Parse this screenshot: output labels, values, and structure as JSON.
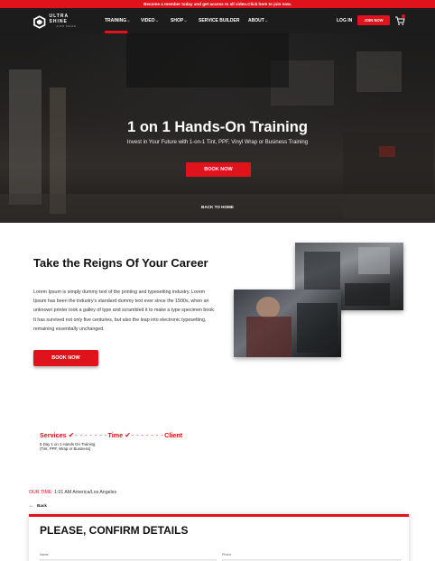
{
  "topbar": {
    "text": "Become a member today and get access to all video.Click here to join now."
  },
  "nav": {
    "logo": {
      "name": "ULTRA SHINE",
      "sub": "AUTO SALON"
    },
    "items": [
      {
        "label": "TRAINING",
        "caret": true,
        "active": true
      },
      {
        "label": "VIDEO",
        "caret": true
      },
      {
        "label": "SHOP",
        "caret": true
      },
      {
        "label": "SERVICE BUILDER",
        "caret": false
      },
      {
        "label": "ABOUT",
        "caret": true
      }
    ],
    "login": "LOG IN",
    "join": "JOIN NOW",
    "cart_icon": "cart-icon"
  },
  "hero": {
    "title": "1 on 1 Hands-On Training",
    "subtitle": "Invest in Your Future with 1-on-1 Tint, PPF, Vinyl Wrap or Business Training",
    "button": "BOOK NOW",
    "back_link": "BACK TO HOME"
  },
  "intro": {
    "title": "Take the Reigns Of Your Career",
    "body": "Lorem Ipsum is simply dummy text of the printing and typesetting industry. Lorem Ipsum has been the industry's standard dummy text ever since the 1500s, when an unknown printer took a galley of type and scrambled it to make a type specimen book. It has survived not only five centuries, but also the leap into electronic typesetting, remaining essentially unchanged.",
    "button": "BOOK NOW"
  },
  "booking": {
    "steps": [
      "Services",
      "Time",
      "Client"
    ],
    "step_dashes": "- - - - - - -",
    "selected_service": "5 Day 1 on 1 Hands On Training (Tint, PPF, Wrap or Business)",
    "our_time_label": "OUR TIME:",
    "our_time_value": "1:01 AM America/Los Angeles",
    "back": "Back",
    "confirm_title": "PLEASE, CONFIRM DETAILS",
    "fields": [
      {
        "label": "Name"
      },
      {
        "label": "Phone"
      }
    ]
  },
  "colors": {
    "accent": "#e0121b",
    "nav_bg": "#1c1c1c"
  }
}
